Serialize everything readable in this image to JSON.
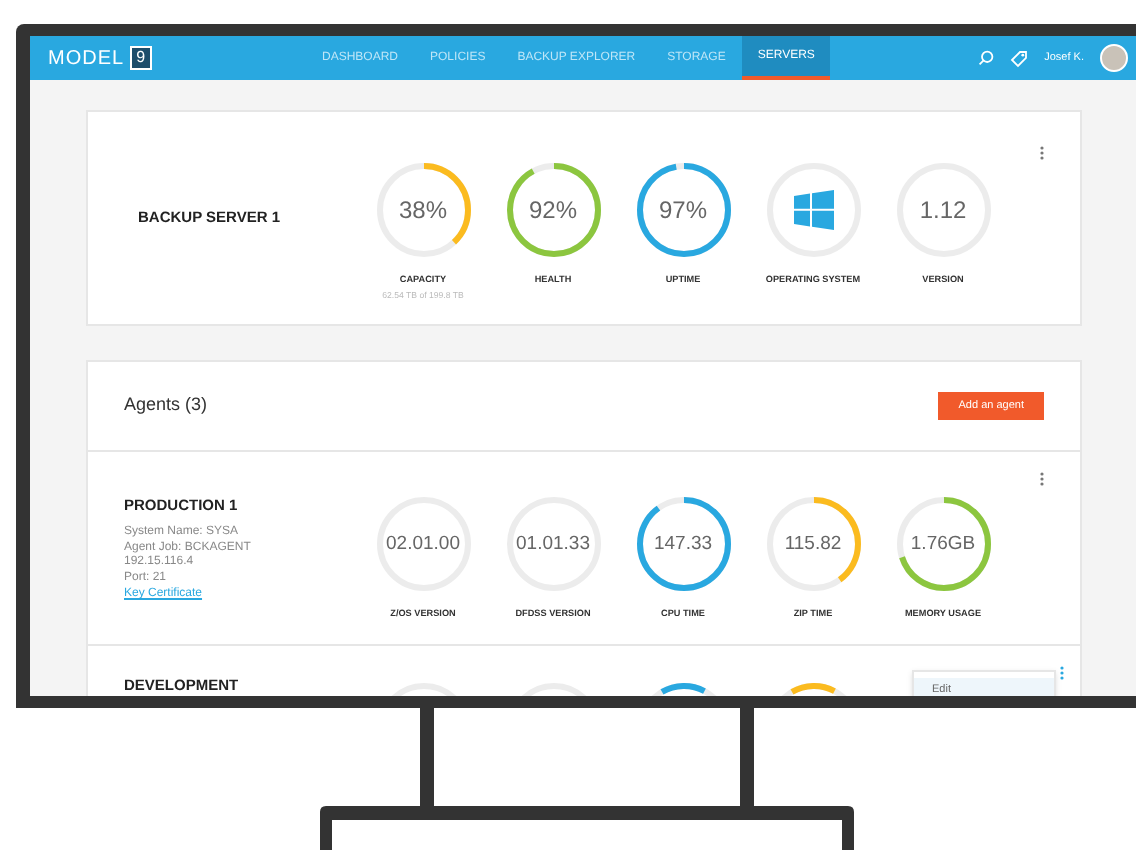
{
  "nav": {
    "logo_text": "MODEL",
    "logo_mark": "9",
    "tabs": [
      {
        "label": "DASHBOARD",
        "selected": false
      },
      {
        "label": "POLICIES",
        "selected": false
      },
      {
        "label": "BACKUP EXPLORER",
        "selected": false
      },
      {
        "label": "STORAGE",
        "selected": false
      },
      {
        "label": "SERVERS",
        "selected": true
      }
    ],
    "user": "Josef K."
  },
  "server": {
    "title": "BACKUP SERVER 1",
    "gauges": [
      {
        "kind": "value",
        "value": "38%",
        "level": 0.38,
        "color": "#fbbb1f",
        "label": "CAPACITY",
        "detail": "62.54 TB of 199.8 TB"
      },
      {
        "kind": "value",
        "value": "92%",
        "level": 0.92,
        "color": "#8cc63f",
        "label": "HEALTH"
      },
      {
        "kind": "value",
        "value": "97%",
        "level": 0.97,
        "color": "#29a8e0",
        "label": "UPTIME"
      },
      {
        "kind": "os",
        "label": "OPERATING SYSTEM"
      },
      {
        "kind": "value",
        "value": "1.12",
        "label": "VERSION"
      }
    ]
  },
  "agents": {
    "title": "Agents (3)",
    "add_button": "Add an agent",
    "rows": [
      {
        "title": "PRODUCTION 1",
        "details": [
          "System Name: SYSA",
          "Agent Job: BCKAGENT",
          "192.15.116.4",
          "Port: 21"
        ],
        "link": "Key Certificate",
        "gauges": [
          {
            "kind": "value",
            "value": "02.01.00",
            "label": "Z/OS VERSION"
          },
          {
            "kind": "value",
            "value": "01.01.33",
            "label": "DFDSS VERSION"
          },
          {
            "kind": "value",
            "value": "147.33",
            "level": 0.9,
            "color": "#29a8e0",
            "label": "CPU TIME"
          },
          {
            "kind": "value",
            "value": "115.82",
            "level": 0.4,
            "color": "#fbbb1f",
            "label": "ZIP TIME"
          },
          {
            "kind": "value",
            "value": "1.76GB",
            "level": 0.7,
            "color": "#8cc63f",
            "label": "MEMORY USAGE"
          }
        ]
      },
      {
        "title": "DEVELOPMENT",
        "gauges": [
          {
            "kind": "partial"
          },
          {
            "kind": "partial"
          },
          {
            "kind": "partial",
            "color": "#29a8e0"
          },
          {
            "kind": "partial",
            "color": "#fbbb1f"
          }
        ],
        "menu": [
          "Edit"
        ]
      }
    ]
  }
}
